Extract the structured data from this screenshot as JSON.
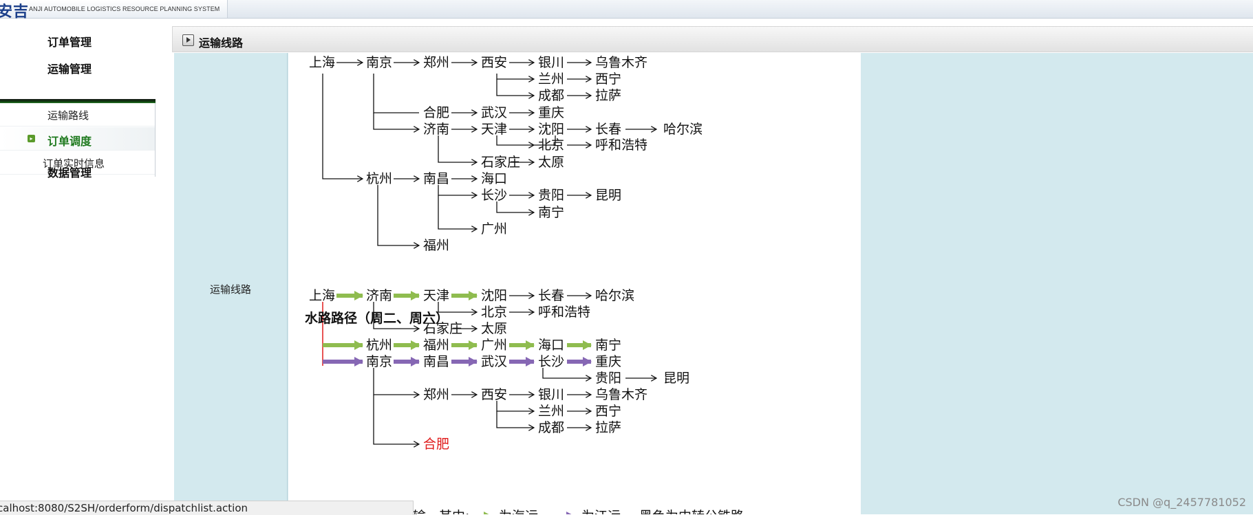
{
  "app": {
    "logo_text": "安吉",
    "logo_subtitle": "ANJI AUTOMOBILE LOGISTICS RESOURCE PLANNING SYSTEM"
  },
  "sidebar": {
    "menu": [
      {
        "label": "订单管理"
      },
      {
        "label": "运输管理"
      },
      {
        "label": "数据管理"
      }
    ],
    "submenu": [
      {
        "label": "运输路线",
        "active": false
      },
      {
        "label": "订单调度",
        "active": true
      },
      {
        "label": "订单实时信息",
        "active": false
      }
    ]
  },
  "panel": {
    "title": "运输线路",
    "row_label": "运输线路"
  },
  "routes": {
    "rail_nodes": [
      "上海",
      "南京",
      "郑州",
      "西安",
      "银川",
      "乌鲁木齐",
      "兰州",
      "西宁",
      "成都",
      "拉萨",
      "合肥",
      "武汉",
      "重庆",
      "济南",
      "天津",
      "沈阳",
      "长春",
      "哈尔滨",
      "北京",
      "呼和浩特",
      "石家庄",
      "太原",
      "杭州",
      "南昌",
      "海口",
      "长沙",
      "贵阳",
      "昆明",
      "南宁",
      "广州",
      "福州"
    ],
    "water_heading": "水路路径（周二、周六）",
    "water_nodes": [
      "上海",
      "济南",
      "天津",
      "沈阳",
      "长春",
      "哈尔滨",
      "北京",
      "呼和浩特",
      "石家庄",
      "太原",
      "杭州",
      "福州",
      "广州",
      "海口",
      "南宁",
      "南京",
      "南昌",
      "武汉",
      "长沙",
      "重庆",
      "贵阳",
      "昆明",
      "郑州",
      "西安",
      "银川",
      "乌鲁木齐",
      "兰州",
      "西宁",
      "成都",
      "拉萨",
      "合肥"
    ],
    "legend": {
      "prefix": "运输，其中:",
      "sea": "为海运",
      "river": "为江运",
      "note": "黑色为中转公铁路。"
    },
    "colors": {
      "sea": "#8fbc4f",
      "river": "#8667b4",
      "highlight": "#e01b1b",
      "link": "#111111"
    }
  },
  "status": {
    "url": "calhost:8080/S2SH/orderform/dispatchlist.action"
  },
  "watermark": "CSDN @q_2457781052"
}
